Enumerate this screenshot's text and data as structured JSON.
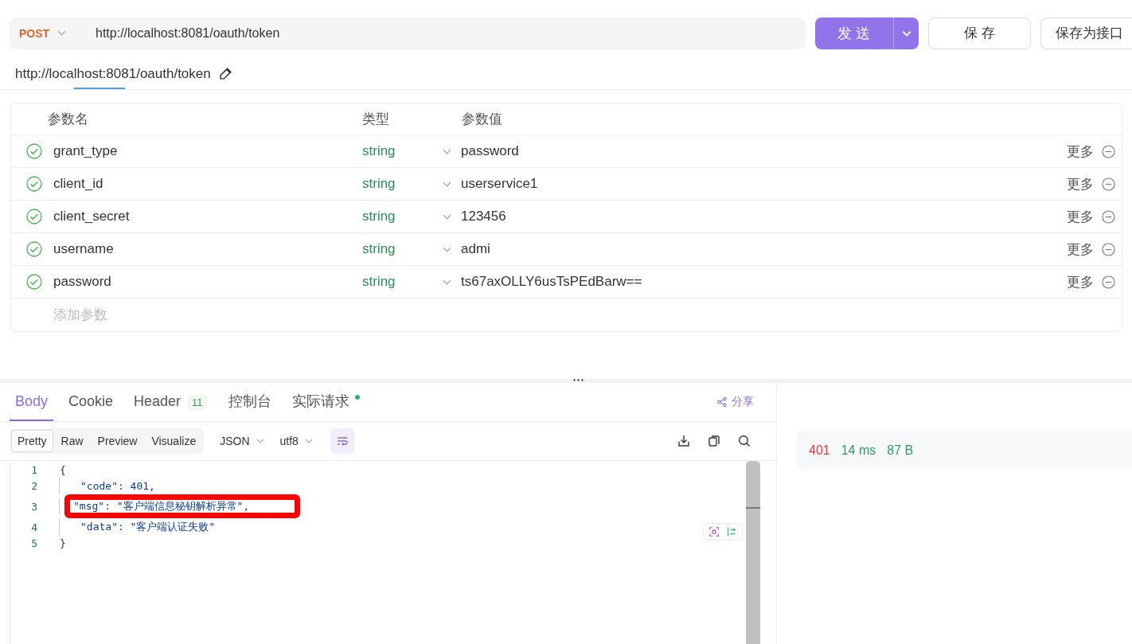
{
  "request": {
    "method": "POST",
    "url": "http://localhost:8081/oauth/token",
    "send": "发 送",
    "save": "保 存",
    "save_as": "保存为接口"
  },
  "title_url": "http://localhost:8081/oauth/token",
  "params": {
    "columns": [
      "参数名",
      "类型",
      "参数值"
    ],
    "rows": [
      {
        "enabled": true,
        "name": "grant_type",
        "type": "string",
        "value": "password",
        "more": "更多"
      },
      {
        "enabled": true,
        "name": "client_id",
        "type": "string",
        "value": "userservice1",
        "more": "更多"
      },
      {
        "enabled": true,
        "name": "client_secret",
        "type": "string",
        "value": "123456",
        "more": "更多"
      },
      {
        "enabled": true,
        "name": "username",
        "type": "string",
        "value": "admi",
        "more": "更多"
      },
      {
        "enabled": true,
        "name": "password",
        "type": "string",
        "value": "ts67axOLLY6usTsPEdBarw==",
        "more": "更多"
      }
    ],
    "add_placeholder": "添加参数"
  },
  "response": {
    "tabs": [
      {
        "label": "Body",
        "selected": true
      },
      {
        "label": "Cookie",
        "selected": false
      },
      {
        "label": "Header",
        "selected": false,
        "badge": "11"
      },
      {
        "label": "控制台",
        "selected": false
      },
      {
        "label": "实际请求",
        "selected": false,
        "dot": true
      }
    ],
    "share": "分享",
    "views": [
      {
        "label": "Pretty",
        "selected": true
      },
      {
        "label": "Raw",
        "selected": false
      },
      {
        "label": "Preview",
        "selected": false
      },
      {
        "label": "Visualize",
        "selected": false
      }
    ],
    "format": "JSON",
    "encoding": "utf8",
    "lines": [
      {
        "number": "1",
        "text": "{",
        "highlight": false
      },
      {
        "number": "2",
        "text": "\"code\": 401,",
        "highlight": false
      },
      {
        "number": "3",
        "text": "\"msg\": \"客户端信息秘钥解析异常\",",
        "highlight": true
      },
      {
        "number": "4",
        "text": "\"data\": \"客户端认证失败\"",
        "highlight": false
      },
      {
        "number": "5",
        "text": "}",
        "highlight": false
      }
    ],
    "status": {
      "code": "401",
      "time": "14 ms",
      "size": "87 B"
    }
  }
}
